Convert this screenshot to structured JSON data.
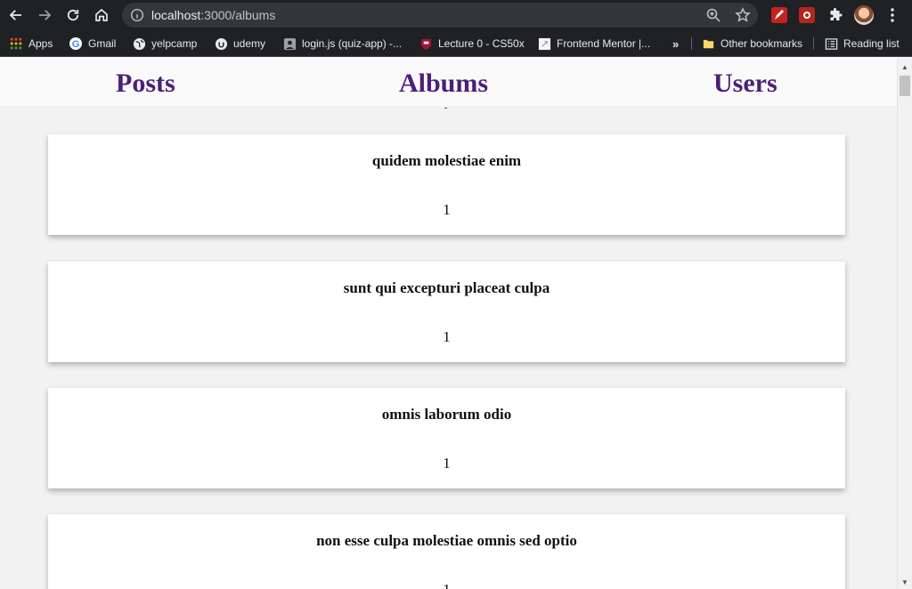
{
  "browser": {
    "url_host": "localhost",
    "url_path": ":3000/albums",
    "bookmarks": [
      {
        "label": "Apps",
        "icon": "apps-grid-icon"
      },
      {
        "label": "Gmail",
        "icon": "google-icon"
      },
      {
        "label": "yelpcamp",
        "icon": "globe-icon"
      },
      {
        "label": "udemy",
        "icon": "udemy-icon"
      },
      {
        "label": "login.js (quiz-app) -...",
        "icon": "user-icon"
      },
      {
        "label": "Lecture 0 - CS50x",
        "icon": "harvard-icon"
      },
      {
        "label": "Frontend Mentor |...",
        "icon": "frontend-mentor-icon"
      }
    ],
    "overflow_label": "»",
    "other_bookmarks": "Other bookmarks",
    "reading_list": "Reading list"
  },
  "nav": {
    "posts": "Posts",
    "albums": "Albums",
    "users": "Users",
    "link_color": "#4b1f7a"
  },
  "albums": [
    {
      "title": "quidem molestiae enim",
      "user_id": "1"
    },
    {
      "title": "sunt qui excepturi placeat culpa",
      "user_id": "1"
    },
    {
      "title": "omnis laborum odio",
      "user_id": "1"
    },
    {
      "title": "non esse culpa molestiae omnis sed optio",
      "user_id": "1"
    }
  ]
}
